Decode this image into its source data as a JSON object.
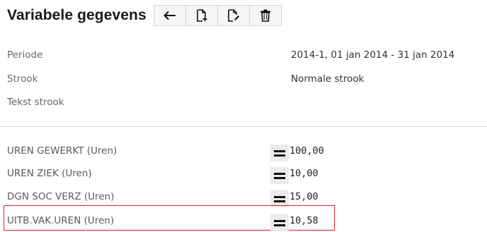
{
  "header": {
    "title": "Variabele gegevens",
    "toolbar": [
      {
        "icon": "arrow-left-icon"
      },
      {
        "icon": "new-document-icon"
      },
      {
        "icon": "edit-document-icon"
      },
      {
        "icon": "trash-icon"
      }
    ]
  },
  "info": {
    "periode_label": "Periode",
    "periode_value": "2014-1, 01 jan 2014 - 31 jan 2014",
    "strook_label": "Strook",
    "strook_value": "Normale strook",
    "tekst_strook_label": "Tekst strook",
    "tekst_strook_value": ""
  },
  "variables": [
    {
      "label": "UREN GEWERKT (Uren)",
      "operator": "=",
      "value": "100,00"
    },
    {
      "label": "UREN ZIEK (Uren)",
      "operator": "=",
      "value": "10,00"
    },
    {
      "label": "DGN SOC VERZ (Uren)",
      "operator": "=",
      "value": "15,00"
    },
    {
      "label": "UITB.VAK.UREN (Uren)",
      "operator": "=",
      "value": "10,58",
      "highlighted": true
    }
  ],
  "colors": {
    "highlight_border": "#d9232d",
    "operator_bg": "#ececec",
    "divider": "#d8d8d8"
  }
}
